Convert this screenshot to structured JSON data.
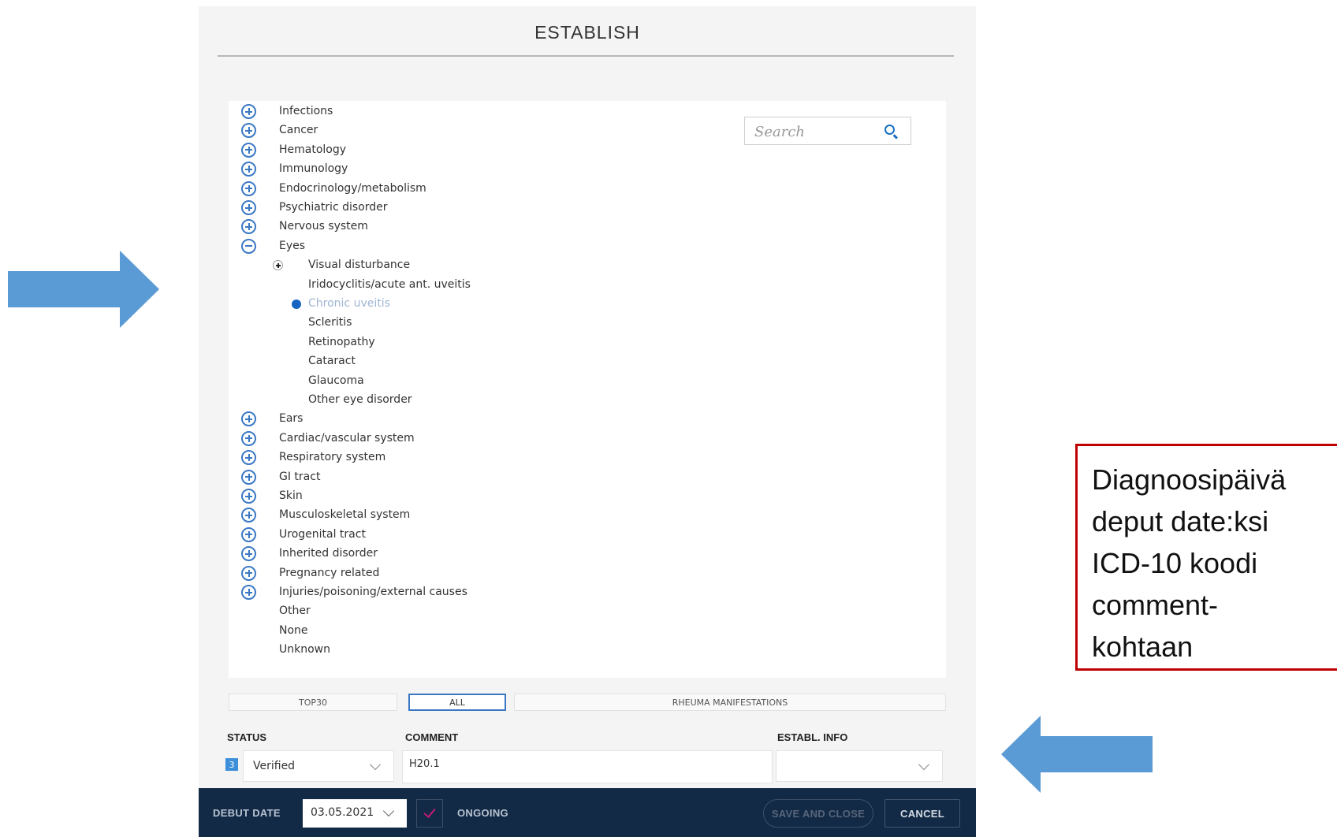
{
  "dialog": {
    "title": "ESTABLISH",
    "search": {
      "placeholder": "Search"
    },
    "tree": [
      {
        "label": "Infections",
        "state": "collapsed"
      },
      {
        "label": "Cancer",
        "state": "collapsed"
      },
      {
        "label": "Hematology",
        "state": "collapsed"
      },
      {
        "label": "Immunology",
        "state": "collapsed"
      },
      {
        "label": "Endocrinology/metabolism",
        "state": "collapsed"
      },
      {
        "label": "Psychiatric disorder",
        "state": "collapsed"
      },
      {
        "label": "Nervous system",
        "state": "collapsed"
      },
      {
        "label": "Eyes",
        "state": "expanded",
        "children": [
          {
            "label": "Visual disturbance",
            "state": "collapsed"
          },
          {
            "label": "Iridocyclitis/acute ant. uveitis",
            "state": "leaf"
          },
          {
            "label": "Chronic uveitis",
            "state": "selected"
          },
          {
            "label": "Scleritis",
            "state": "leaf"
          },
          {
            "label": "Retinopathy",
            "state": "leaf"
          },
          {
            "label": "Cataract",
            "state": "leaf"
          },
          {
            "label": "Glaucoma",
            "state": "leaf"
          },
          {
            "label": "Other eye disorder",
            "state": "leaf"
          }
        ]
      },
      {
        "label": "Ears",
        "state": "collapsed"
      },
      {
        "label": "Cardiac/vascular system",
        "state": "collapsed"
      },
      {
        "label": "Respiratory system",
        "state": "collapsed"
      },
      {
        "label": "GI tract",
        "state": "collapsed"
      },
      {
        "label": "Skin",
        "state": "collapsed"
      },
      {
        "label": "Musculoskeletal system",
        "state": "collapsed"
      },
      {
        "label": "Urogenital tract",
        "state": "collapsed"
      },
      {
        "label": "Inherited disorder",
        "state": "collapsed"
      },
      {
        "label": "Pregnancy related",
        "state": "collapsed"
      },
      {
        "label": "Injuries/poisoning/external causes",
        "state": "collapsed"
      },
      {
        "label": "Other",
        "state": "leaf"
      },
      {
        "label": "None",
        "state": "leaf"
      },
      {
        "label": "Unknown",
        "state": "leaf"
      }
    ],
    "tabs": {
      "top30": "TOP30",
      "all": "ALL",
      "rheuma": "RHEUMA MANIFESTATIONS",
      "active": "all"
    },
    "status": {
      "label": "STATUS",
      "icon_text": "3",
      "value": "Verified"
    },
    "comment": {
      "label": "COMMENT",
      "value": "H20.1"
    },
    "establ_info": {
      "label": "ESTABL. INFO",
      "value": ""
    },
    "footer": {
      "debut_date_label": "DEBUT DATE",
      "debut_date_value": "03.05.2021",
      "ongoing_label": "ONGOING",
      "ongoing_checked": true,
      "save_and_close": "SAVE AND CLOSE",
      "cancel": "CANCEL"
    }
  },
  "annotation": {
    "callout_lines": [
      "Diagnoosipäivä",
      "deput date:ksi",
      "ICD-10 koodi",
      "comment-",
      "kohtaan"
    ]
  },
  "colors": {
    "accent": "#3b78c4",
    "selected": "#1565c0",
    "footer_bg": "#132a46",
    "arrow": "#5b9bd5",
    "callout_border": "#c00000"
  }
}
